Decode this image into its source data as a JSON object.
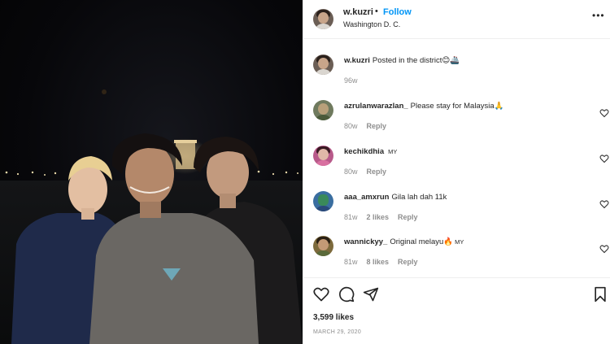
{
  "post": {
    "username": "w.kuzri",
    "separator": "•",
    "follow_label": "Follow",
    "location": "Washington D. C.",
    "more_icon": "more-options-icon"
  },
  "caption": {
    "username": "w.kuzri",
    "text": "Posted in the district😊🚢",
    "time": "96w"
  },
  "comments": [
    {
      "username": "azrulanwarazlan_",
      "text": "Please stay for Malaysia🙏",
      "tag": "",
      "time": "80w",
      "likes": "",
      "reply": "Reply",
      "avatar_bg": "#6f7a5e"
    },
    {
      "username": "kechikdhia",
      "text": "",
      "tag": "MY",
      "time": "80w",
      "likes": "",
      "reply": "Reply",
      "avatar_bg": "#b85a8a"
    },
    {
      "username": "aaa_amxrun",
      "text": "Gila lah dah 11k",
      "tag": "",
      "time": "81w",
      "likes": "2 likes",
      "reply": "Reply",
      "avatar_bg": "#3a6ea0"
    },
    {
      "username": "wannickyy_",
      "text": "Original melayu🔥",
      "tag": "MY",
      "time": "81w",
      "likes": "8 likes",
      "reply": "Reply",
      "avatar_bg": "#7d6a3c"
    }
  ],
  "footer": {
    "likes": "3,599 likes",
    "date": "MARCH 29, 2020"
  },
  "icons": {
    "like": "heart-icon",
    "comment": "comment-icon",
    "share": "share-icon",
    "save": "bookmark-icon"
  },
  "colors": {
    "follow": "#0095f6",
    "muted": "#8e8e8e",
    "text": "#262626"
  }
}
